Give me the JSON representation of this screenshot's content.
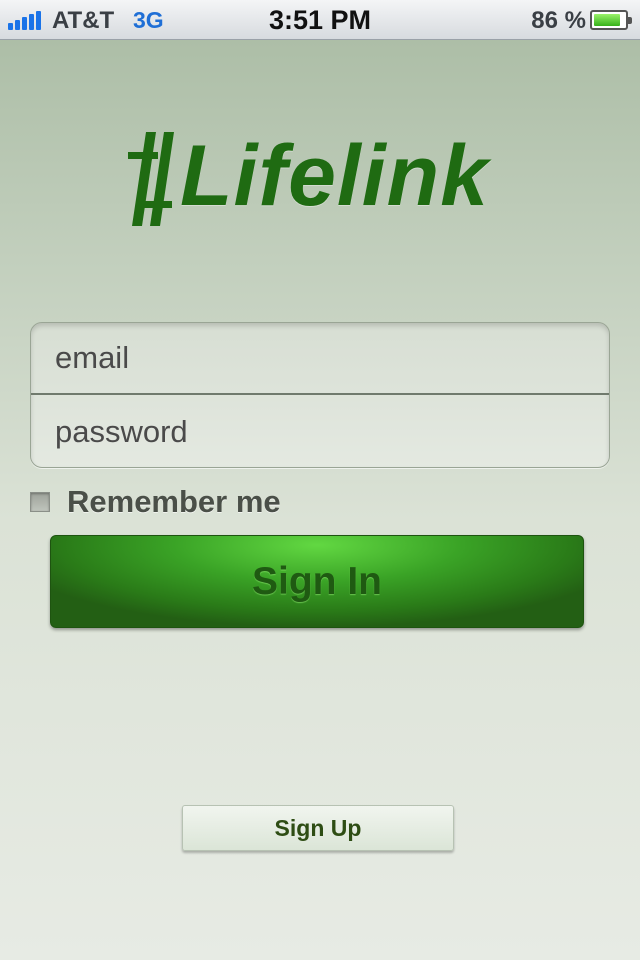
{
  "status_bar": {
    "carrier": "AT&T",
    "network": "3G",
    "time": "3:51 PM",
    "battery_percent": "86 %",
    "battery_level": 0.86,
    "signal_icon": "signal-bars-icon",
    "battery_icon": "battery-icon"
  },
  "logo": {
    "text": "Lifelink",
    "mark_icon": "lifelink-mark-icon",
    "color": "#1f6b12"
  },
  "login_form": {
    "email_placeholder": "email",
    "email_value": "",
    "password_placeholder": "password",
    "password_value": ""
  },
  "remember_me": {
    "label": "Remember me",
    "checked": false
  },
  "sign_in": {
    "label": "Sign In",
    "color": "#3aa326"
  },
  "sign_up": {
    "label": "Sign Up"
  }
}
